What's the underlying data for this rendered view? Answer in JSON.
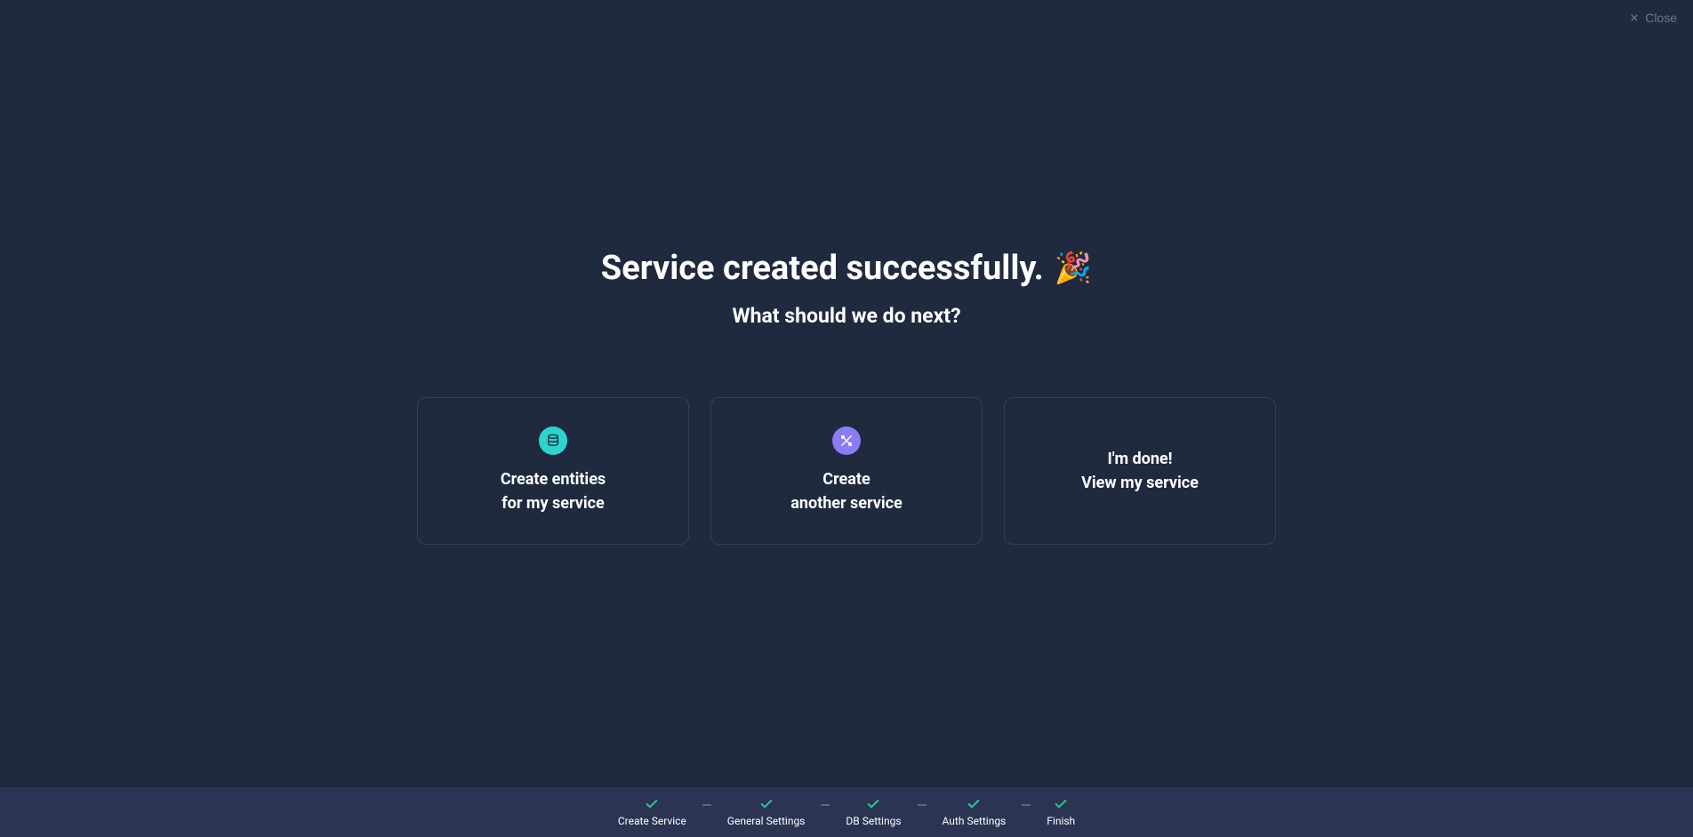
{
  "close": {
    "label": "Close"
  },
  "header": {
    "title": "Service created successfully.",
    "emoji": "🎉",
    "subtitle": "What should we do next?"
  },
  "options": {
    "create_entities": {
      "line1": "Create entities",
      "line2": "for my service"
    },
    "create_another": {
      "line1": "Create",
      "line2": "another service"
    },
    "done": {
      "line1": "I'm done!",
      "line2": "View my service"
    }
  },
  "progress": {
    "steps": [
      {
        "label": "Create Service"
      },
      {
        "label": "General Settings"
      },
      {
        "label": "DB Settings"
      },
      {
        "label": "Auth Settings"
      },
      {
        "label": "Finish"
      }
    ]
  }
}
